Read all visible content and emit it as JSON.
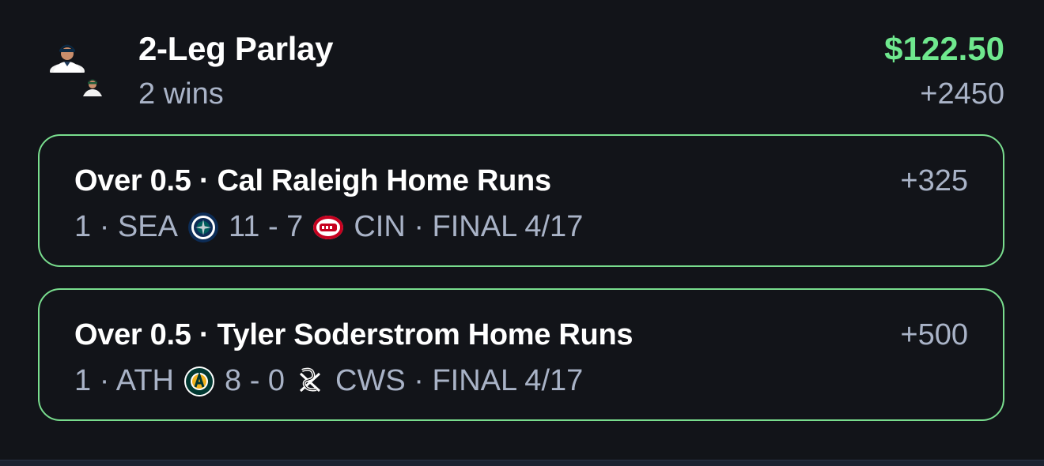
{
  "parlay": {
    "title": "2-Leg Parlay",
    "subtitle": "2 wins",
    "payout": "$122.50",
    "odds": "+2450",
    "payout_color": "#6fe88e"
  },
  "legs": [
    {
      "title": "Over 0.5 · Cal Raleigh Home Runs",
      "odds": "+325",
      "line": {
        "prefix": "1 · SEA",
        "score": "11 - 7",
        "suffix": "CIN · FINAL 4/17"
      },
      "home_logo": "mariners-logo-icon",
      "away_logo": "reds-logo-icon"
    },
    {
      "title": "Over 0.5 · Tyler Soderstrom Home Runs",
      "odds": "+500",
      "line": {
        "prefix": "1 · ATH",
        "score": "8 - 0",
        "suffix": "CWS · FINAL 4/17"
      },
      "home_logo": "athletics-logo-icon",
      "away_logo": "white-sox-logo-icon"
    }
  ],
  "colors": {
    "win_border": "#79dd8e",
    "muted_text": "#a9b3c7",
    "background": "#121419"
  }
}
